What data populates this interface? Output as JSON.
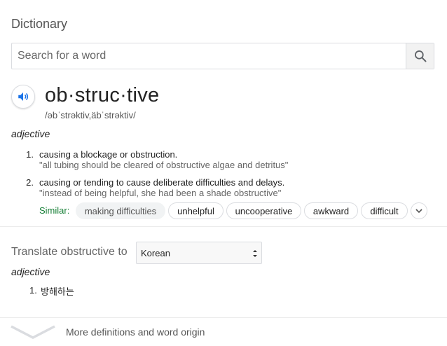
{
  "panel": {
    "title": "Dictionary"
  },
  "search": {
    "placeholder": "Search for a word",
    "value": ""
  },
  "entry": {
    "word": "ob·struc·tive",
    "phonetic": "/əbˈstrəktiv,äbˈstrəktiv/",
    "part_of_speech": "adjective",
    "definitions": [
      {
        "number": "1.",
        "text": "causing a blockage or obstruction.",
        "example": "\"all tubing should be cleared of obstructive algae and detritus\""
      },
      {
        "number": "2.",
        "text": "causing or tending to cause deliberate difficulties and delays.",
        "example": "\"instead of being helpful, she had been a shade obstructive\""
      }
    ],
    "similar_label": "Similar:",
    "similar": [
      "making difficulties",
      "unhelpful",
      "uncooperative",
      "awkward",
      "difficult"
    ]
  },
  "translate": {
    "label": "Translate obstructive to",
    "language": "Korean",
    "part_of_speech": "adjective",
    "results": [
      {
        "number": "1.",
        "text": "방해하는"
      }
    ]
  },
  "footer": {
    "more_label": "More definitions and word origin"
  },
  "colors": {
    "similar_label": "#188038",
    "speaker_icon": "#1a73e8",
    "divider": "#ebebeb"
  },
  "icons": {
    "search": "search-icon",
    "speaker": "speaker-icon",
    "expand": "chevron-down-icon",
    "more": "chevron-down-icon"
  }
}
